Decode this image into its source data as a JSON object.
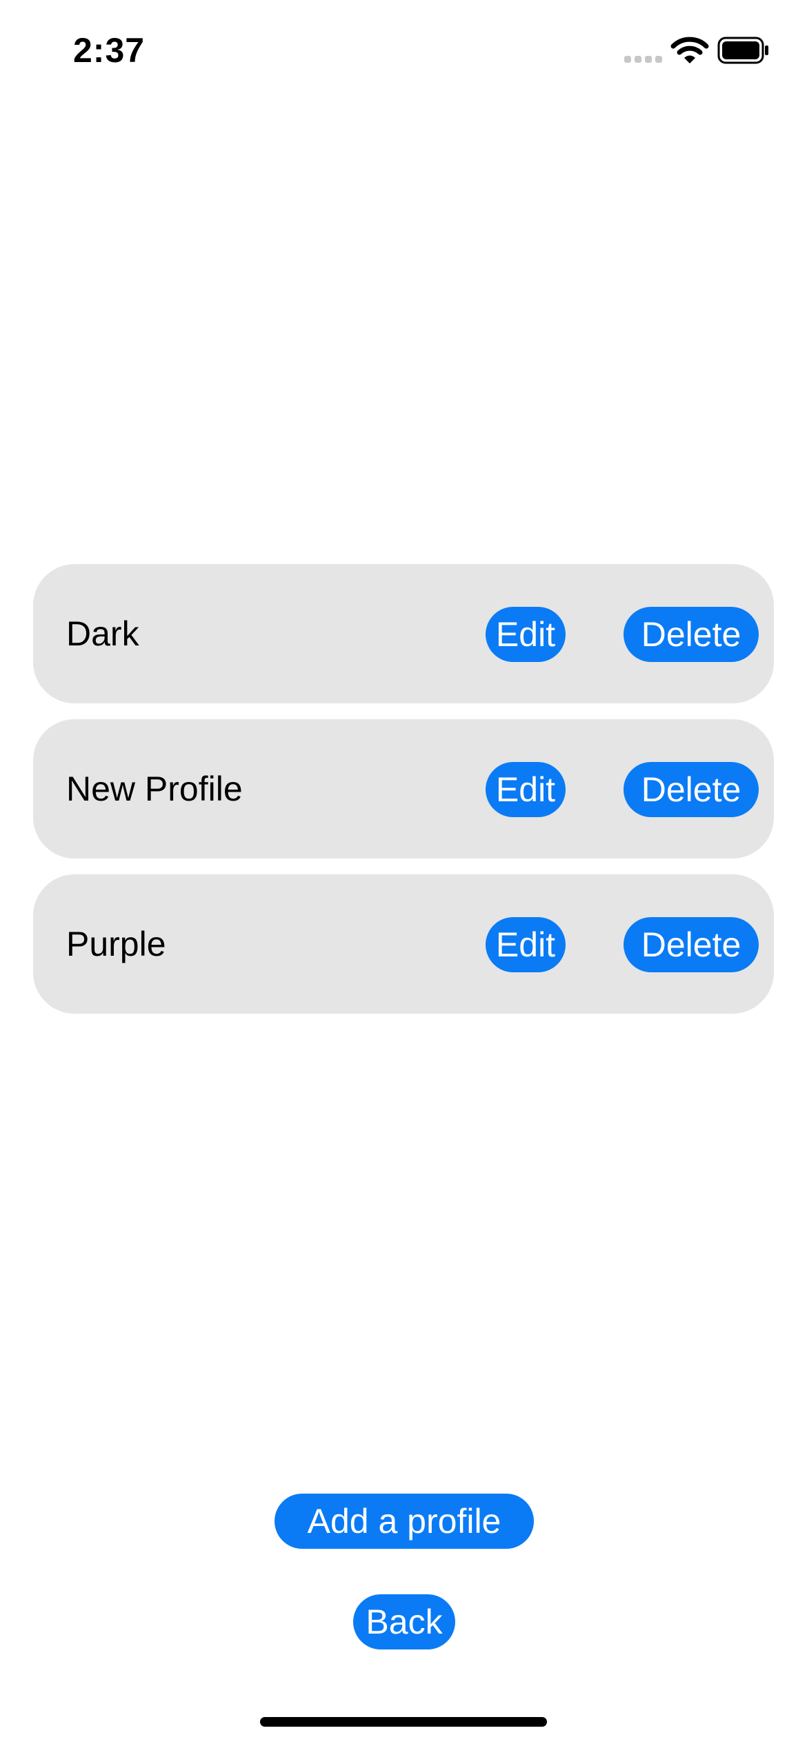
{
  "status_bar": {
    "time": "2:37",
    "icons": [
      "cellular-signal-icon",
      "wifi-icon",
      "battery-icon"
    ]
  },
  "profiles": [
    {
      "name": "Dark",
      "edit_label": "Edit",
      "delete_label": "Delete"
    },
    {
      "name": "New Profile",
      "edit_label": "Edit",
      "delete_label": "Delete"
    },
    {
      "name": "Purple",
      "edit_label": "Edit",
      "delete_label": "Delete"
    }
  ],
  "actions": {
    "add_profile_label": "Add a profile",
    "back_label": "Back"
  },
  "colors": {
    "accent": "#0a7bf5",
    "row_background": "#e5e5e5",
    "background": "#ffffff",
    "text": "#000000",
    "button_text": "#ffffff"
  }
}
